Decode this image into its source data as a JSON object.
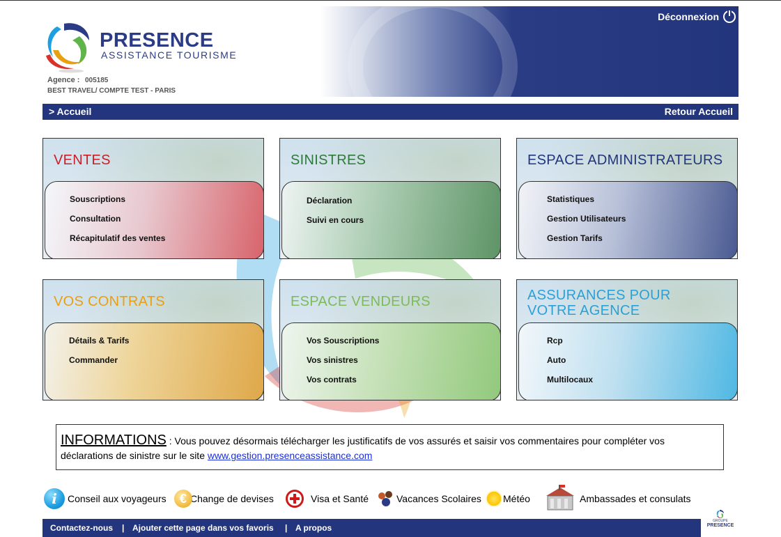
{
  "header": {
    "brand_name": "PRESENCE",
    "brand_sub": "ASSISTANCE TOURISME",
    "agency_label": "Agence :",
    "agency_id": "005185",
    "agency_name": "BEST TRAVEL/ COMPTE TEST - PARIS",
    "logout_label": "Déconnexion",
    "logout_icon": "power-icon"
  },
  "nav": {
    "breadcrumb": "> Accueil",
    "back_home": "Retour Accueil"
  },
  "cards": [
    {
      "title": "VENTES",
      "color": "#c8202a",
      "items": [
        "Souscriptions",
        "Consultation",
        "Récapitulatif des ventes"
      ]
    },
    {
      "title": "SINISTRES",
      "color": "#2e7a3a",
      "items": [
        "Déclaration",
        "Suivi en cours"
      ]
    },
    {
      "title": "ESPACE ADMINISTRATEURS",
      "color": "#22357d",
      "items": [
        "Statistiques",
        "Gestion Utilisateurs",
        "Gestion Tarifs"
      ]
    },
    {
      "title": "VOS CONTRATS",
      "color": "#e8a013",
      "items": [
        "Détails & Tarifs",
        "Commander"
      ]
    },
    {
      "title": "ESPACE VENDEURS",
      "color": "#7dbb5a",
      "items": [
        "Vos Souscriptions",
        "Vos sinistres",
        "Vos contrats"
      ]
    },
    {
      "title_line1": "ASSURANCES POUR",
      "title_line2": "VOTRE AGENCE",
      "color": "#2aa0d8",
      "items": [
        "Rcp",
        "Auto",
        "Multilocaux"
      ]
    }
  ],
  "info": {
    "title": "INFORMATIONS",
    "text": " : Vous pouvez désormais télécharger les justificatifs de vos assurés et saisir vos commentaires pour compléter vos déclarations de sinistre  sur le site ",
    "link": "www.gestion.presenceassistance.com"
  },
  "quick_links": [
    {
      "label": "Conseil aux voyageurs",
      "icon": "info-icon"
    },
    {
      "label": "Change de devises",
      "icon": "euro-icon",
      "glyph": "€"
    },
    {
      "label": "Visa et Santé",
      "icon": "red-cross-icon"
    },
    {
      "label": "Vacances Scolaires",
      "icon": "children-icon"
    },
    {
      "label": "Météo",
      "icon": "sun-icon"
    },
    {
      "label": "Ambassades et consulats",
      "icon": "embassy-icon"
    }
  ],
  "footer": {
    "contact": "Contactez-nous",
    "sep": "|",
    "favorites": "Ajouter cette page dans vos favoris",
    "about": "A propos",
    "group_small": "GROUPE",
    "group_big": "PRESENCE"
  },
  "colors": {
    "navy": "#22357d",
    "brand": "#2c3b86",
    "link": "#1a2fd8"
  }
}
